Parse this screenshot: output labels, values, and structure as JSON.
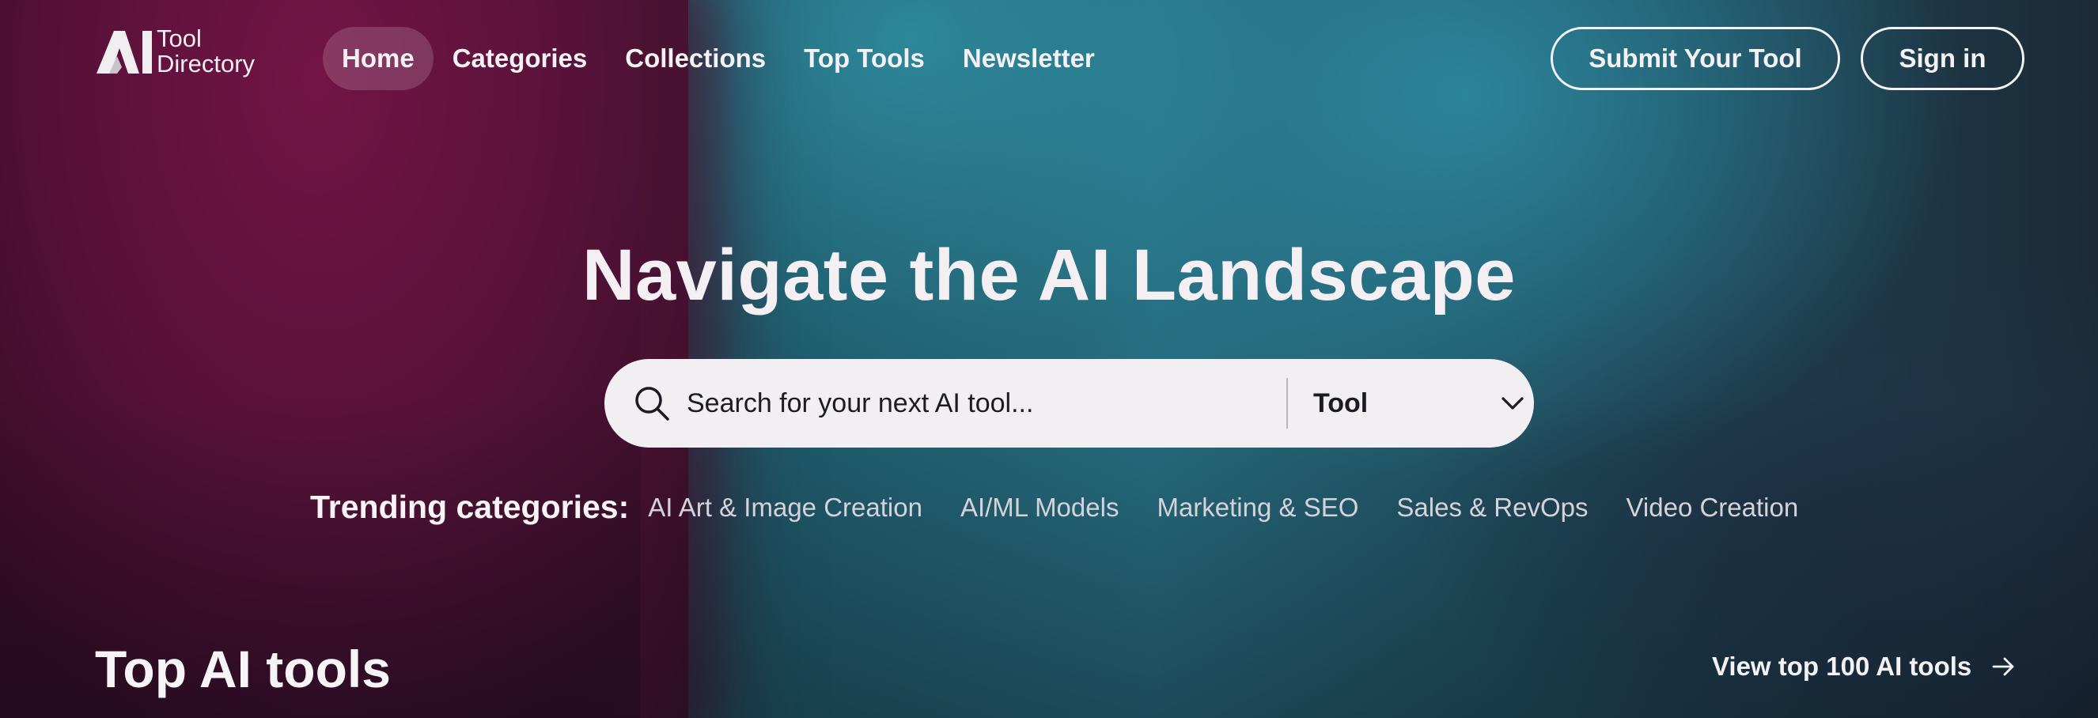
{
  "header": {
    "logo_mark": "AI",
    "logo_line1": "Tool",
    "logo_line2": "Directory",
    "nav": [
      {
        "label": "Home",
        "active": true
      },
      {
        "label": "Categories"
      },
      {
        "label": "Collections"
      },
      {
        "label": "Top Tools"
      },
      {
        "label": "Newsletter"
      }
    ],
    "submit_label": "Submit Your Tool",
    "signin_label": "Sign in"
  },
  "hero": {
    "title": "Navigate the AI Landscape",
    "search_placeholder": "Search for your next AI tool...",
    "search_type": "Tool",
    "search_icon": "search-icon",
    "chevron_icon": "chevron-down-icon"
  },
  "trending": {
    "label": "Trending categories:",
    "items": [
      "AI Art & Image Creation",
      "AI/ML Models",
      "Marketing & SEO",
      "Sales & RevOps",
      "Video Creation"
    ]
  },
  "top_tools": {
    "title": "Top AI tools",
    "view_all_label": "View top 100 AI tools",
    "arrow_icon": "arrow-right-icon"
  },
  "colors": {
    "accent_magenta": "#5a0f37",
    "accent_teal": "#266d7f",
    "text": "#f3f1f4",
    "search_bg": "#f2eff3"
  }
}
